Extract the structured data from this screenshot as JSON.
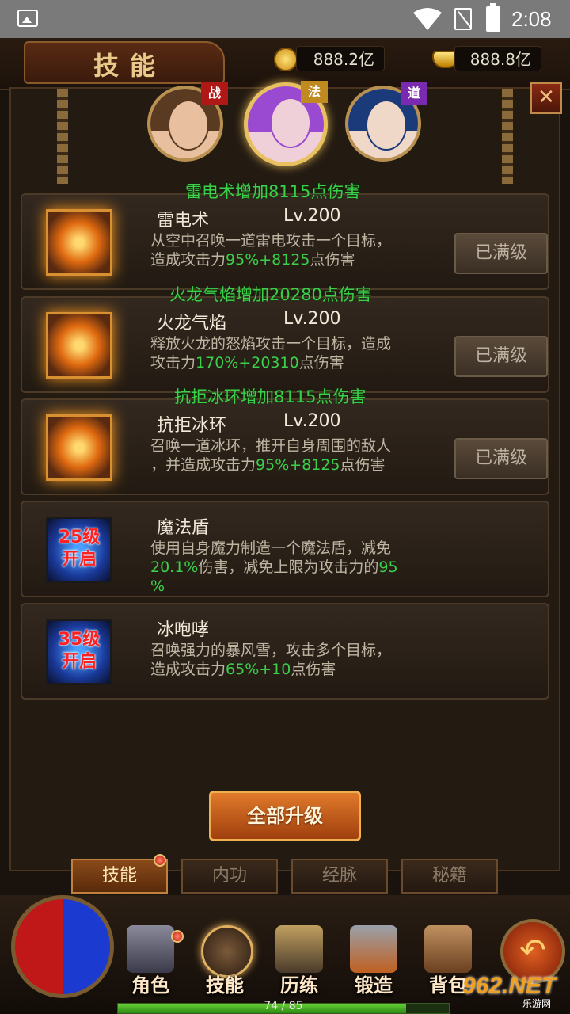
{
  "status_bar": {
    "time": "2:08"
  },
  "header": {
    "title": "技能",
    "currency_gold": "888.2亿",
    "currency_ingot": "888.8亿"
  },
  "characters": [
    {
      "class_label": "战",
      "badge_color": "#b01818",
      "hair_color": "#5a3a20",
      "face_color": "#e8c0a0"
    },
    {
      "class_label": "法",
      "badge_color": "#c08a20",
      "hair_color": "#9a4ad0",
      "face_color": "#f0d0d8",
      "selected": true
    },
    {
      "class_label": "道",
      "badge_color": "#7a2ab0",
      "hair_color": "#1a3a7a",
      "face_color": "#f0d8c8"
    }
  ],
  "skills": [
    {
      "bonus": "雷电术增加8115点伤害",
      "name": "雷电术",
      "level": "Lv.200",
      "desc_a": "从空中召唤一道雷电攻击一个目标，",
      "desc_b": "造成攻击力",
      "desc_hl": "95%+8125",
      "desc_c": "点伤害",
      "button": "已满级",
      "state": "active"
    },
    {
      "bonus": "火龙气焰增加20280点伤害",
      "name": "火龙气焰",
      "level": "Lv.200",
      "desc_a": "释放火龙的怒焰攻击一个目标，造成",
      "desc_b": "攻击力",
      "desc_hl": "170%+20310",
      "desc_c": "点伤害",
      "button": "已满级",
      "state": "active"
    },
    {
      "bonus": "抗拒冰环增加8115点伤害",
      "name": "抗拒冰环",
      "level": "Lv.200",
      "desc_a": "召唤一道冰环，推开自身周围的敌人",
      "desc_b": "，并造成攻击力",
      "desc_hl": "95%+8125",
      "desc_c": "点伤害",
      "button": "已满级",
      "state": "active"
    },
    {
      "name": "魔法盾",
      "lock": "25级开启",
      "lock_l1": "25级",
      "lock_l2": "开启",
      "desc_a": "使用自身魔力制造一个魔法盾，减免",
      "desc_hl": "20.1%",
      "desc_b": "伤害，减免上限为攻击力的",
      "desc_hl2": "95",
      "desc_hl3": "%",
      "state": "locked"
    },
    {
      "name": "冰咆哮",
      "lock": "35级开启",
      "lock_l1": "35级",
      "lock_l2": "开启",
      "desc_a": "召唤强力的暴风雪，攻击多个目标，",
      "desc_b": "造成攻击力",
      "desc_hl": "65%+10",
      "desc_c": "点伤害",
      "state": "locked"
    }
  ],
  "upgrade_all": "全部升级",
  "tabs": [
    {
      "label": "技能",
      "active": true
    },
    {
      "label": "内功"
    },
    {
      "label": "经脉"
    },
    {
      "label": "秘籍"
    }
  ],
  "nav": [
    {
      "label": "角色",
      "icon": "helmet-icon"
    },
    {
      "label": "技能",
      "icon": "skill-book-icon",
      "selected": true
    },
    {
      "label": "历练",
      "icon": "armor-icon"
    },
    {
      "label": "锻造",
      "icon": "hammer-icon"
    },
    {
      "label": "背包",
      "icon": "bag-icon"
    }
  ],
  "exp": {
    "text": "74 / 85",
    "current": 74,
    "max": 85
  },
  "watermark": {
    "brand": "962.NET",
    "sub": "乐游网"
  }
}
